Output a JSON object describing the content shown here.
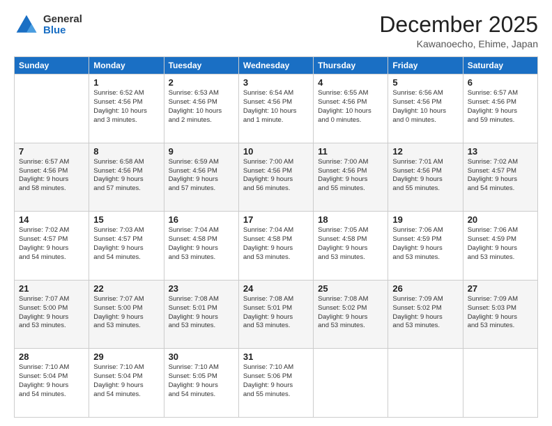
{
  "header": {
    "logo_general": "General",
    "logo_blue": "Blue",
    "month_title": "December 2025",
    "location": "Kawanoecho, Ehime, Japan"
  },
  "days_of_week": [
    "Sunday",
    "Monday",
    "Tuesday",
    "Wednesday",
    "Thursday",
    "Friday",
    "Saturday"
  ],
  "weeks": [
    [
      {
        "day": "",
        "info": ""
      },
      {
        "day": "1",
        "info": "Sunrise: 6:52 AM\nSunset: 4:56 PM\nDaylight: 10 hours\nand 3 minutes."
      },
      {
        "day": "2",
        "info": "Sunrise: 6:53 AM\nSunset: 4:56 PM\nDaylight: 10 hours\nand 2 minutes."
      },
      {
        "day": "3",
        "info": "Sunrise: 6:54 AM\nSunset: 4:56 PM\nDaylight: 10 hours\nand 1 minute."
      },
      {
        "day": "4",
        "info": "Sunrise: 6:55 AM\nSunset: 4:56 PM\nDaylight: 10 hours\nand 0 minutes."
      },
      {
        "day": "5",
        "info": "Sunrise: 6:56 AM\nSunset: 4:56 PM\nDaylight: 10 hours\nand 0 minutes."
      },
      {
        "day": "6",
        "info": "Sunrise: 6:57 AM\nSunset: 4:56 PM\nDaylight: 9 hours\nand 59 minutes."
      }
    ],
    [
      {
        "day": "7",
        "info": "Sunrise: 6:57 AM\nSunset: 4:56 PM\nDaylight: 9 hours\nand 58 minutes."
      },
      {
        "day": "8",
        "info": "Sunrise: 6:58 AM\nSunset: 4:56 PM\nDaylight: 9 hours\nand 57 minutes."
      },
      {
        "day": "9",
        "info": "Sunrise: 6:59 AM\nSunset: 4:56 PM\nDaylight: 9 hours\nand 57 minutes."
      },
      {
        "day": "10",
        "info": "Sunrise: 7:00 AM\nSunset: 4:56 PM\nDaylight: 9 hours\nand 56 minutes."
      },
      {
        "day": "11",
        "info": "Sunrise: 7:00 AM\nSunset: 4:56 PM\nDaylight: 9 hours\nand 55 minutes."
      },
      {
        "day": "12",
        "info": "Sunrise: 7:01 AM\nSunset: 4:56 PM\nDaylight: 9 hours\nand 55 minutes."
      },
      {
        "day": "13",
        "info": "Sunrise: 7:02 AM\nSunset: 4:57 PM\nDaylight: 9 hours\nand 54 minutes."
      }
    ],
    [
      {
        "day": "14",
        "info": "Sunrise: 7:02 AM\nSunset: 4:57 PM\nDaylight: 9 hours\nand 54 minutes."
      },
      {
        "day": "15",
        "info": "Sunrise: 7:03 AM\nSunset: 4:57 PM\nDaylight: 9 hours\nand 54 minutes."
      },
      {
        "day": "16",
        "info": "Sunrise: 7:04 AM\nSunset: 4:58 PM\nDaylight: 9 hours\nand 53 minutes."
      },
      {
        "day": "17",
        "info": "Sunrise: 7:04 AM\nSunset: 4:58 PM\nDaylight: 9 hours\nand 53 minutes."
      },
      {
        "day": "18",
        "info": "Sunrise: 7:05 AM\nSunset: 4:58 PM\nDaylight: 9 hours\nand 53 minutes."
      },
      {
        "day": "19",
        "info": "Sunrise: 7:06 AM\nSunset: 4:59 PM\nDaylight: 9 hours\nand 53 minutes."
      },
      {
        "day": "20",
        "info": "Sunrise: 7:06 AM\nSunset: 4:59 PM\nDaylight: 9 hours\nand 53 minutes."
      }
    ],
    [
      {
        "day": "21",
        "info": "Sunrise: 7:07 AM\nSunset: 5:00 PM\nDaylight: 9 hours\nand 53 minutes."
      },
      {
        "day": "22",
        "info": "Sunrise: 7:07 AM\nSunset: 5:00 PM\nDaylight: 9 hours\nand 53 minutes."
      },
      {
        "day": "23",
        "info": "Sunrise: 7:08 AM\nSunset: 5:01 PM\nDaylight: 9 hours\nand 53 minutes."
      },
      {
        "day": "24",
        "info": "Sunrise: 7:08 AM\nSunset: 5:01 PM\nDaylight: 9 hours\nand 53 minutes."
      },
      {
        "day": "25",
        "info": "Sunrise: 7:08 AM\nSunset: 5:02 PM\nDaylight: 9 hours\nand 53 minutes."
      },
      {
        "day": "26",
        "info": "Sunrise: 7:09 AM\nSunset: 5:02 PM\nDaylight: 9 hours\nand 53 minutes."
      },
      {
        "day": "27",
        "info": "Sunrise: 7:09 AM\nSunset: 5:03 PM\nDaylight: 9 hours\nand 53 minutes."
      }
    ],
    [
      {
        "day": "28",
        "info": "Sunrise: 7:10 AM\nSunset: 5:04 PM\nDaylight: 9 hours\nand 54 minutes."
      },
      {
        "day": "29",
        "info": "Sunrise: 7:10 AM\nSunset: 5:04 PM\nDaylight: 9 hours\nand 54 minutes."
      },
      {
        "day": "30",
        "info": "Sunrise: 7:10 AM\nSunset: 5:05 PM\nDaylight: 9 hours\nand 54 minutes."
      },
      {
        "day": "31",
        "info": "Sunrise: 7:10 AM\nSunset: 5:06 PM\nDaylight: 9 hours\nand 55 minutes."
      },
      {
        "day": "",
        "info": ""
      },
      {
        "day": "",
        "info": ""
      },
      {
        "day": "",
        "info": ""
      }
    ]
  ]
}
